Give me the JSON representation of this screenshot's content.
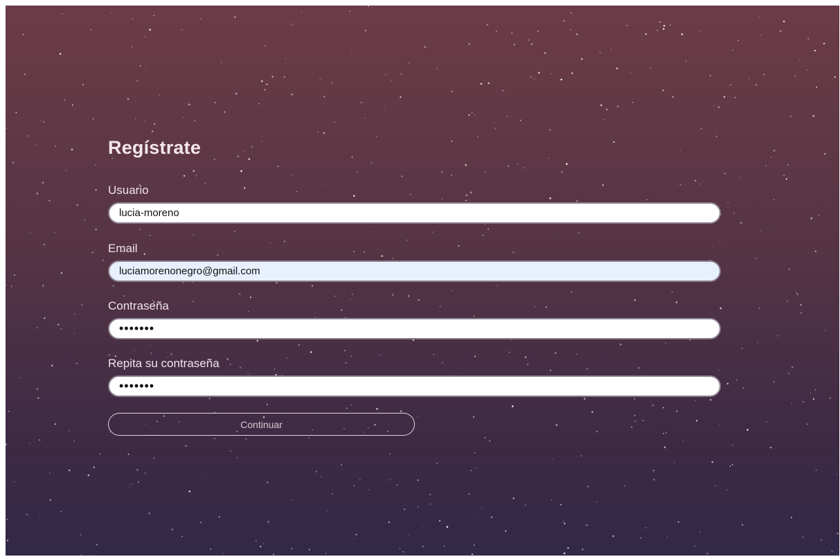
{
  "form": {
    "title": "Regístrate",
    "fields": [
      {
        "label": "Usuario",
        "value": "lucia-moreno",
        "type": "text"
      },
      {
        "label": "Email",
        "value": "luciamorenonegro@gmail.com",
        "type": "email"
      },
      {
        "label": "Contraseña",
        "value": "1234567",
        "type": "password"
      },
      {
        "label": "Repita su contraseña",
        "value": "1234567",
        "type": "password"
      }
    ],
    "submit_label": "Continuar"
  },
  "colors": {
    "background_top": "#6b3c47",
    "background_bottom": "#322848",
    "autofill_background": "#e8f0fe",
    "text_light": "#efe3ea"
  }
}
